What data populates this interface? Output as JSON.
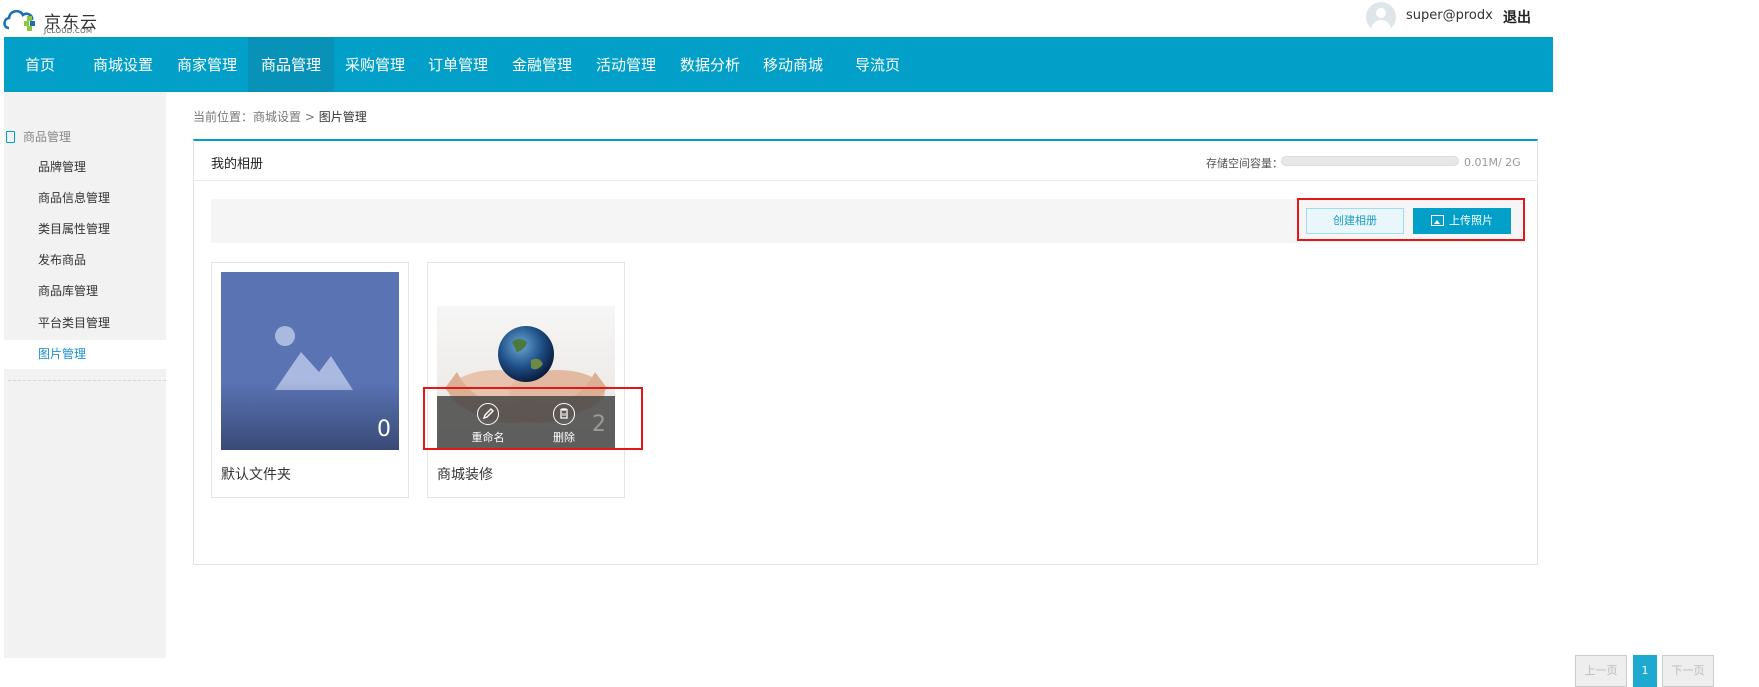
{
  "header": {
    "logo_cn": "京东云",
    "logo_en": "JCLOUD.COM",
    "username": "super@prodx",
    "logout": "退出"
  },
  "nav": {
    "items": [
      "首页",
      "商城设置",
      "商家管理",
      "商品管理",
      "采购管理",
      "订单管理",
      "金融管理",
      "活动管理",
      "数据分析",
      "移动商城",
      "导流页"
    ],
    "active": "商品管理"
  },
  "sidebar": {
    "section": "商品管理",
    "items": [
      "品牌管理",
      "商品信息管理",
      "类目属性管理",
      "发布商品",
      "商品库管理",
      "平台类目管理",
      "图片管理"
    ],
    "active": "图片管理"
  },
  "breadcrumb": {
    "prefix": "当前位置：",
    "parent": "商城设置",
    "separator": ">",
    "current": "图片管理"
  },
  "panel": {
    "title": "我的相册",
    "storage_label": "存储空间容量：",
    "storage_value": "0.01M/ 2G",
    "storage_fraction": 5e-06
  },
  "toolbar": {
    "create_album": "创建相册",
    "upload_photo": "上传照片"
  },
  "albums": [
    {
      "name": "默认文件夹",
      "count": "0"
    },
    {
      "name": "商城装修",
      "count": "2",
      "actions": {
        "rename": "重命名",
        "delete": "删除"
      }
    }
  ],
  "pagination": {
    "prev": "上一页",
    "current": "1",
    "next": "下一页"
  },
  "colors": {
    "primary": "#02a0c8",
    "nav_active": "#0892b8",
    "highlight_box": "#e01818"
  }
}
